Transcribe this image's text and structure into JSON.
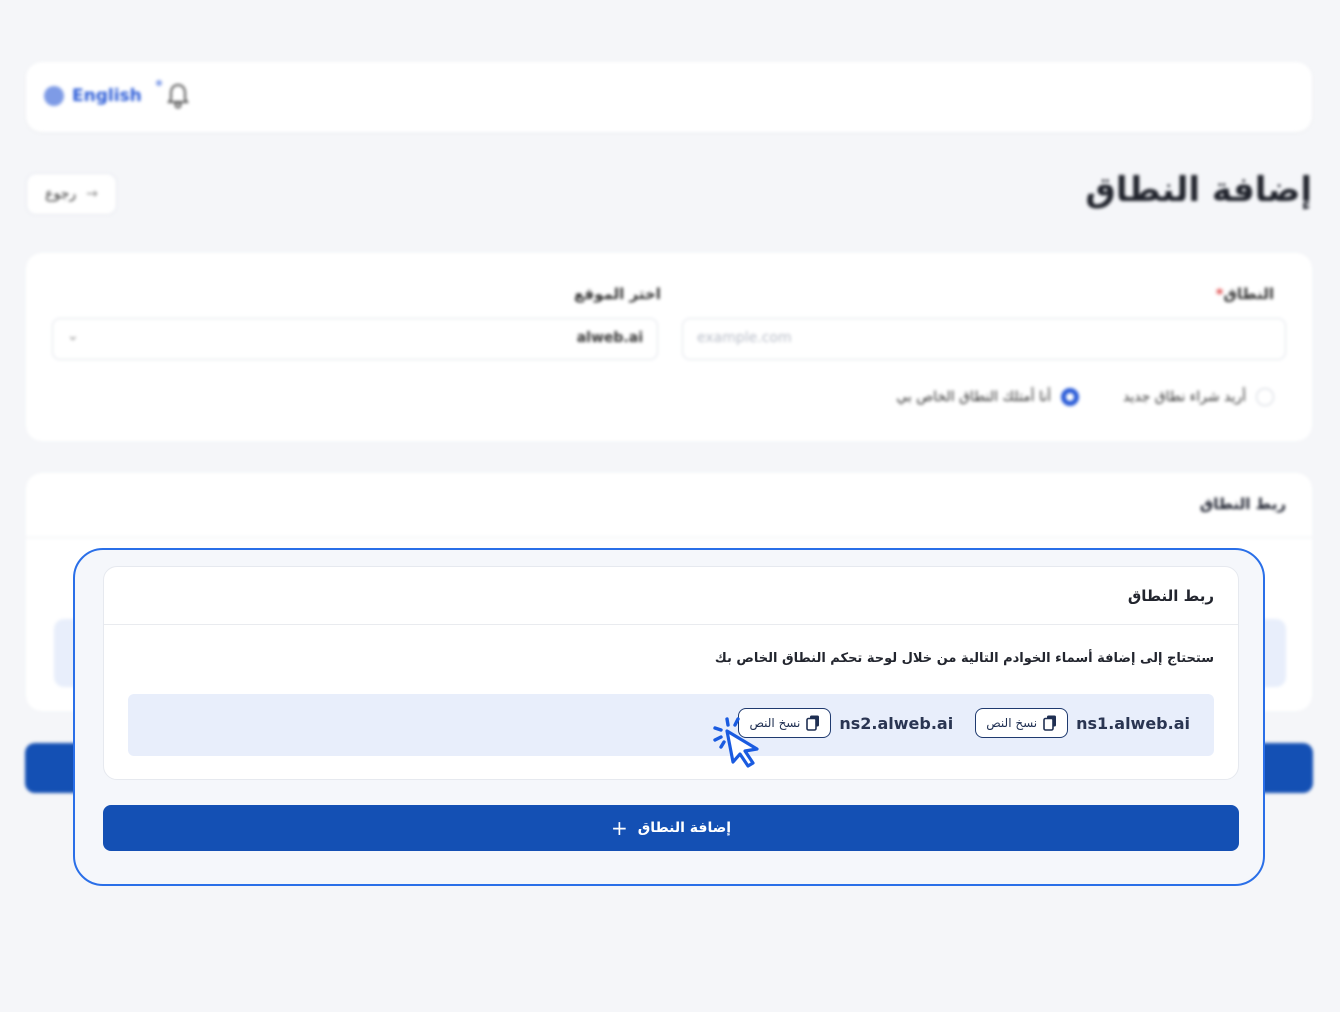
{
  "topbar": {
    "language": "English"
  },
  "page": {
    "title": "إضافة النطاق",
    "back_label": "رجوع"
  },
  "domain_form": {
    "domain_label": "النطاق",
    "domain_placeholder": "example.com",
    "site_label": "اختر الموقع",
    "site_value": "alweb.ai",
    "option_buy": "أريد شراء نطاق جديد",
    "option_own": "أنا أمتلك النطاق الخاص بي",
    "selected_option": "option_own"
  },
  "link_card": {
    "title": "ربط النطاق",
    "description": "ستحتاج إلى إضافة أسماء الخوادم التالية من خلال لوحة تحكم النطاق الخاص بك",
    "nameservers": [
      {
        "name": "ns1.alweb.ai",
        "copy_label": "نسخ النص"
      },
      {
        "name": "ns2.alweb.ai",
        "copy_label": "نسخ النص"
      }
    ]
  },
  "submit": {
    "label": "إضافة النطاق"
  },
  "colors": {
    "primary": "#1450b4",
    "focus_border": "#2a6fe8",
    "nameserver_bg": "#e8eefb"
  }
}
